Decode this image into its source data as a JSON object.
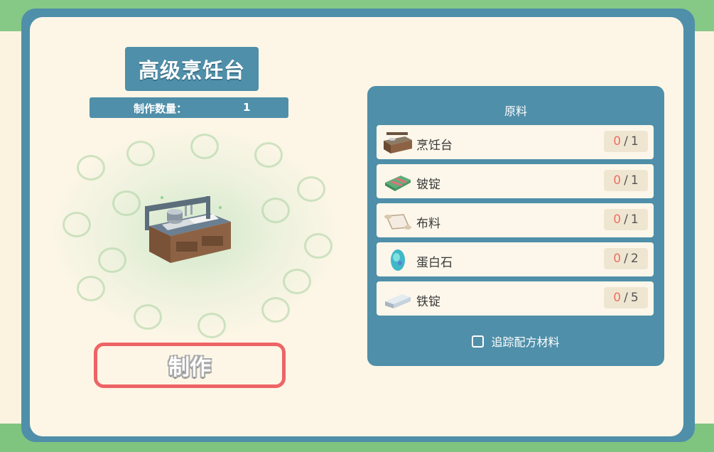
{
  "recipe": {
    "title": "高级烹饪台",
    "quantity_label": "制作数量：",
    "quantity_value": "1",
    "craft_button_label": "制作"
  },
  "materials": {
    "header": "原料",
    "items": [
      {
        "name": "烹饪台",
        "icon": "cooking-table-icon",
        "have": "0",
        "sep": "/",
        "need": "1"
      },
      {
        "name": "铍锭",
        "icon": "beryllium-ingot-icon",
        "have": "0",
        "sep": "/",
        "need": "1"
      },
      {
        "name": "布料",
        "icon": "cloth-icon",
        "have": "0",
        "sep": "/",
        "need": "1"
      },
      {
        "name": "蛋白石",
        "icon": "opal-icon",
        "have": "0",
        "sep": "/",
        "need": "2"
      },
      {
        "name": "铁锭",
        "icon": "iron-ingot-icon",
        "have": "0",
        "sep": "/",
        "need": "5"
      }
    ],
    "track_label": "追踪配方材料",
    "track_checked": false
  },
  "colors": {
    "panel": "#4f8fa9",
    "background": "#fdf6e6",
    "craft_border": "#ee6466",
    "count_have": "#f07060"
  }
}
